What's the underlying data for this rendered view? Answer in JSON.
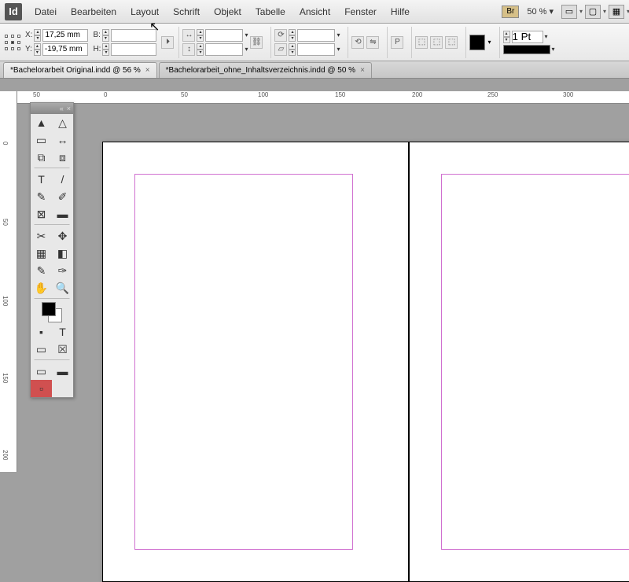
{
  "menu": {
    "items": [
      "Datei",
      "Bearbeiten",
      "Layout",
      "Schrift",
      "Objekt",
      "Tabelle",
      "Ansicht",
      "Fenster",
      "Hilfe"
    ],
    "br": "Br",
    "zoom": "50 %"
  },
  "controls": {
    "x_label": "X:",
    "x": "17,25 mm",
    "y_label": "Y:",
    "y": "-19,75 mm",
    "w_label": "B:",
    "w": "",
    "h_label": "H:",
    "h": "",
    "stroke_weight": "1 Pt"
  },
  "tabs": [
    {
      "label": "*Bachelorarbeit Original.indd @ 56 %",
      "active": true
    },
    {
      "label": "*Bachelorarbeit_ohne_Inhaltsverzeichnis.indd @ 50 %",
      "active": false
    }
  ],
  "ruler_h": [
    {
      "v": "50",
      "p": 20
    },
    {
      "v": "0",
      "p": 110
    },
    {
      "v": "50",
      "p": 208
    },
    {
      "v": "100",
      "p": 306
    },
    {
      "v": "150",
      "p": 404
    },
    {
      "v": "200",
      "p": 502
    },
    {
      "v": "250",
      "p": 598
    },
    {
      "v": "300",
      "p": 694
    }
  ],
  "ruler_v": [
    {
      "v": "0",
      "p": 64
    },
    {
      "v": "50",
      "p": 162
    },
    {
      "v": "100",
      "p": 260
    },
    {
      "v": "150",
      "p": 358
    },
    {
      "v": "200",
      "p": 456
    }
  ],
  "tools": [
    "selection",
    "direct-selection",
    "page",
    "gap",
    "content-collector",
    "content-placer",
    "type",
    "line",
    "pen",
    "pencil",
    "rectangle-frame",
    "rectangle",
    "scissors",
    "free-transform",
    "gradient-swatch",
    "gradient-feather",
    "note",
    "eyedropper",
    "hand",
    "zoom"
  ],
  "tool_glyphs": {
    "selection": "▲",
    "direct-selection": "△",
    "page": "▭",
    "gap": "↔",
    "content-collector": "⧉",
    "content-placer": "⧈",
    "type": "T",
    "line": "/",
    "pen": "✎",
    "pencil": "✐",
    "rectangle-frame": "⊠",
    "rectangle": "▬",
    "scissors": "✂",
    "free-transform": "✥",
    "gradient-swatch": "▦",
    "gradient-feather": "◧",
    "note": "✎",
    "eyedropper": "✑",
    "hand": "✋",
    "zoom": "🔍"
  }
}
